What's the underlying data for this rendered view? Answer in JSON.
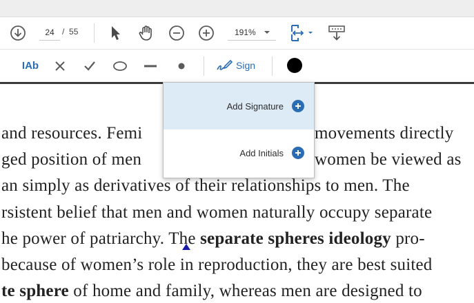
{
  "toolbar": {
    "page_current": "24",
    "page_separator": "/",
    "page_total": "55",
    "zoom_value": "191%",
    "icons": {
      "download": "download-circle-icon",
      "select": "cursor-arrow-icon",
      "hand": "hand-pan-icon",
      "zoom_out": "zoom-out-icon",
      "zoom_in": "zoom-in-icon",
      "zoom_dropdown": "chevron-down-icon",
      "fit_page": "fit-page-icon",
      "page_display": "page-display-icon"
    }
  },
  "fill_sign": {
    "tools": [
      {
        "name": "text-tool",
        "label": "IAb"
      },
      {
        "name": "cross-mark-tool",
        "icon": "x-icon"
      },
      {
        "name": "check-mark-tool",
        "icon": "checkmark-icon"
      },
      {
        "name": "circle-tool",
        "icon": "ellipse-icon"
      },
      {
        "name": "line-tool",
        "icon": "line-icon"
      },
      {
        "name": "dot-tool",
        "icon": "dot-icon"
      }
    ],
    "sign_label": "Sign",
    "ink_color": "#000000"
  },
  "signature_menu": {
    "items": [
      {
        "label": "Add Signature",
        "highlighted": true
      },
      {
        "label": "Add Initials",
        "highlighted": false
      }
    ]
  },
  "document": {
    "lines": [
      {
        "parts": [
          {
            "t": "and resources. Femi",
            "b": false
          },
          {
            "t": "movements directly",
            "b": false
          }
        ]
      },
      {
        "parts": [
          {
            "t": "ged position of men",
            "b": false
          },
          {
            "t": "women be viewed as",
            "b": false
          }
        ]
      },
      {
        "parts": [
          {
            "t": "an simply as derivatives of their relationships to men. The",
            "b": false
          }
        ]
      },
      {
        "parts": [
          {
            "t": "rsistent belief that men and women naturally occupy separate",
            "b": false
          }
        ]
      },
      {
        "parts": [
          {
            "t": "he power of patriarchy. The ",
            "b": false
          },
          {
            "t": "separate spheres ideology",
            "b": true
          },
          {
            "t": " pro-",
            "b": false
          }
        ]
      },
      {
        "parts": [
          {
            "t": "because of women’s role in reproduction, they are best suited",
            "b": false
          }
        ]
      },
      {
        "parts": [
          {
            "t": "te sphere",
            "b": true
          },
          {
            "t": " of home and family, whereas men are designed to",
            "b": false
          }
        ]
      }
    ]
  },
  "colors": {
    "accent": "#2a6db5",
    "menu_highlight": "#ddebf7",
    "icon_gray": "#5a5a5a"
  }
}
